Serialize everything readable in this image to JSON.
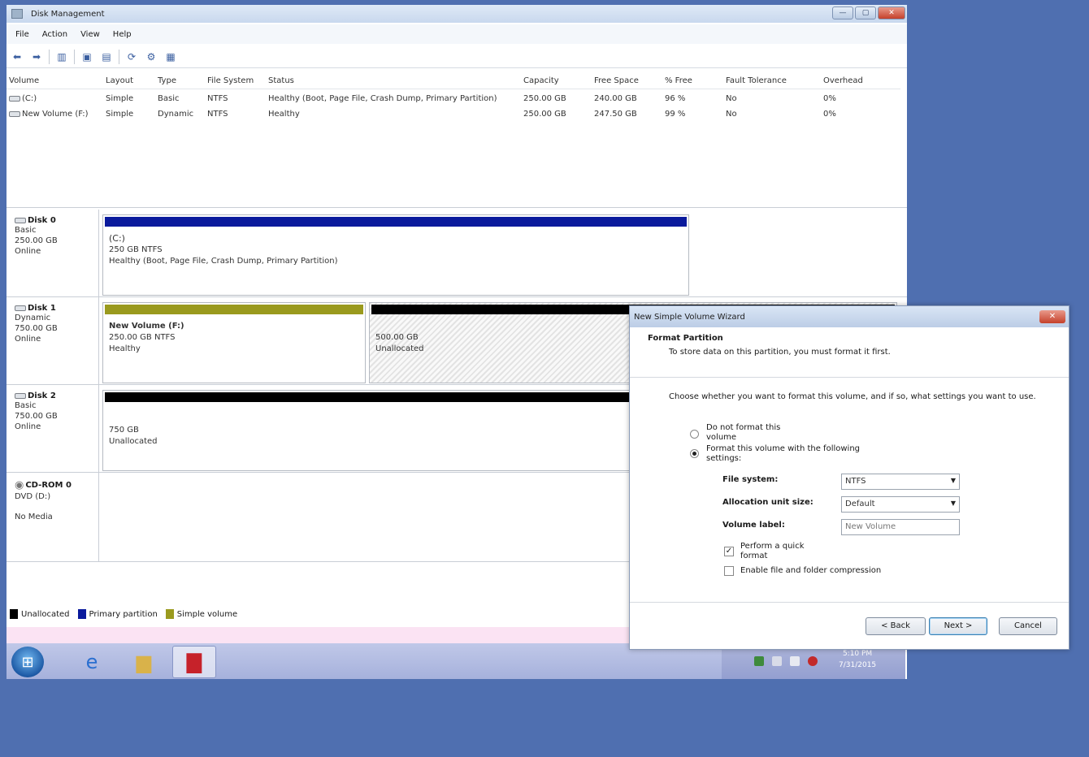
{
  "window": {
    "title": "Disk Management",
    "controls": [
      "minimize",
      "maximize",
      "close"
    ]
  },
  "menu": [
    "File",
    "Action",
    "View",
    "Help"
  ],
  "toolbar_icons": [
    "back-arrow-icon",
    "forward-arrow-icon",
    "console-tree-icon",
    "help-icon",
    "properties-icon",
    "refresh-icon",
    "settings-icon",
    "disk-icon"
  ],
  "volume_table": {
    "headers": [
      "Volume",
      "Layout",
      "Type",
      "File System",
      "Status",
      "Capacity",
      "Free Space",
      "% Free",
      "Fault Tolerance",
      "Overhead"
    ],
    "rows": [
      {
        "volume": "(C:)",
        "layout": "Simple",
        "type": "Basic",
        "fs": "NTFS",
        "status": "Healthy (Boot, Page File, Crash Dump, Primary Partition)",
        "capacity": "250.00 GB",
        "free": "240.00 GB",
        "pct": "96 %",
        "fault": "No",
        "overhead": "0%"
      },
      {
        "volume": "New Volume (F:)",
        "layout": "Simple",
        "type": "Dynamic",
        "fs": "NTFS",
        "status": "Healthy",
        "capacity": "250.00 GB",
        "free": "247.50 GB",
        "pct": "99 %",
        "fault": "No",
        "overhead": "0%"
      }
    ]
  },
  "disks": [
    {
      "name": "Disk 0",
      "type": "Basic",
      "size": "250.00 GB",
      "state": "Online",
      "partitions": [
        {
          "title": "(C:)",
          "line1": "250 GB NTFS",
          "line2": "Healthy (Boot, Page File, Crash Dump, Primary Partition)",
          "color": "#0a1a9c"
        }
      ]
    },
    {
      "name": "Disk 1",
      "type": "Dynamic",
      "size": "750.00 GB",
      "state": "Online",
      "partitions": [
        {
          "title": "New Volume (F:)",
          "line1": "250.00 GB NTFS",
          "line2": "Healthy",
          "color": "#9a9a1e"
        },
        {
          "title": "",
          "line1": "500.00 GB",
          "line2": "Unallocated",
          "color": "#000000"
        }
      ]
    },
    {
      "name": "Disk 2",
      "type": "Basic",
      "size": "750.00 GB",
      "state": "Online",
      "partitions": [
        {
          "title": "",
          "line1": "750 GB",
          "line2": "Unallocated",
          "color": "#000000"
        }
      ]
    },
    {
      "name": "CD-ROM 0",
      "type": "DVD (D:)",
      "size": "",
      "state": "No Media",
      "partitions": []
    }
  ],
  "legend": [
    {
      "label": "Unallocated",
      "color": "#000000"
    },
    {
      "label": "Primary partition",
      "color": "#0a1a9c"
    },
    {
      "label": "Simple volume",
      "color": "#9a9a1e"
    }
  ],
  "taskbar": {
    "apps": [
      "internet-explorer-icon",
      "explorer-folder-icon",
      "disk-management-toolbox-icon"
    ],
    "clock_time": "5:10 PM",
    "clock_date": "7/31/2015"
  },
  "wizard": {
    "title": "New Simple Volume Wizard",
    "heading": "Format Partition",
    "subheading": "To store data on this partition, you must format it first.",
    "intro": "Choose whether you want to format this volume, and if so, what settings you want to use.",
    "option_no_format": "Do not format this volume",
    "option_format": "Format this volume with the following settings:",
    "file_system_label": "File system:",
    "file_system_value": "NTFS",
    "alloc_label": "Allocation unit size:",
    "alloc_value": "Default",
    "volume_label_label": "Volume label:",
    "volume_label_value": "New Volume",
    "quick_format": "Perform a quick format",
    "compression": "Enable file and folder compression",
    "back": "< Back",
    "next": "Next >",
    "cancel": "Cancel"
  }
}
